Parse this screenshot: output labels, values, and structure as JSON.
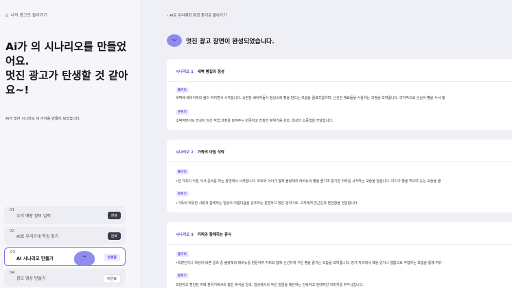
{
  "sidebar": {
    "back_label": "나의 광고로 돌아가기",
    "title": "Ai가 의 시나리오를 만들었어요.\n멋진 광고가 탄생할 것 같아요~!",
    "subtitle": "Ai가 멋진 시나리오 세 가지를 만들어 보았습니다.",
    "steps": [
      {
        "num": "01",
        "label": "우리 매장 정보 입력",
        "badge": "완료"
      },
      {
        "num": "02",
        "label": "AI로 우리가게 특징 찾기",
        "badge": "완료"
      },
      {
        "num": "03",
        "label": "AI 시나리오 만들기",
        "badge": "진행중"
      },
      {
        "num": "04",
        "label": "광고 영상 만들기",
        "badge": "미완료"
      }
    ]
  },
  "main": {
    "breadcrumb": "AI로 우리매장 특징 찾기로 돌아가기",
    "heading": "멋진 광고 장면이 완성되었습니다.",
    "scenarios": [
      {
        "label": "시나리오 1",
        "title": "새벽 빵집의 정성",
        "plot_tag": "줄거리",
        "plot": "새벽에 베이커리의 불이 켜지면서 시작합니다. 숙련된 베이커들이 정성스레 빵을 만드는 모습을 클로즈업하며, 신선한 재료들을 사용하는 과정을 보여줍니다. 마지막으로 손님이 빵을 사서 행",
        "mood_tag": "분위기",
        "mood": "소박하면서도 진심이 담긴 작업 과정을 보여주는 따뜻하고 진솔한 분위기를 강조, 일상의 소중함을 전달합니다."
      },
      {
        "label": "시나리오 2",
        "title": "가족의 아침 식탁",
        "plot_tag": "줄거리",
        "plot": "•한 가족이 아침 식사 준비를 하는 장면에서 시작합니다. 부모와 아이가 함께 블랑제리 에비뉴의 빵을 즐기며 활기찬 하루를 시작하는 모습을 담습니다. 아이가 빵을 먹으며 웃는 모습을 클",
        "mood_tag": "분위기",
        "mood": "•가족의 따뜻한 사랑과 함께하는 일상의 아름다움을 강조하는 훈훈하고 밝은 분위기로, 고객에게 친근감과 편안함을 전달합니다."
      },
      {
        "label": "시나리오 3",
        "title": "커피와 함께하는 휴식",
        "plot_tag": "줄거리",
        "plot": "•직장인이나 학생이 바쁜 일과 중 블랑제리 에비뉴를 방문하여 커피와 함께 신선하게 구운 빵을 즐기는 모습을 보여줍니다. 창가 자리에서 책을 읽거나 랩톱으로 작업하는 모습을 통해 여유",
        "mood_tag": "분위기",
        "mood": "모던하고 편안한 카페 분위기에서의 짧은 휴식을 강조, 일상에서의 작은 일탈을 제안하는 안락하고 현대적인 이미지를 부각시킵니다."
      }
    ]
  },
  "colors": {
    "accent": "#5b4fd8",
    "blob": "#8f8bef"
  }
}
